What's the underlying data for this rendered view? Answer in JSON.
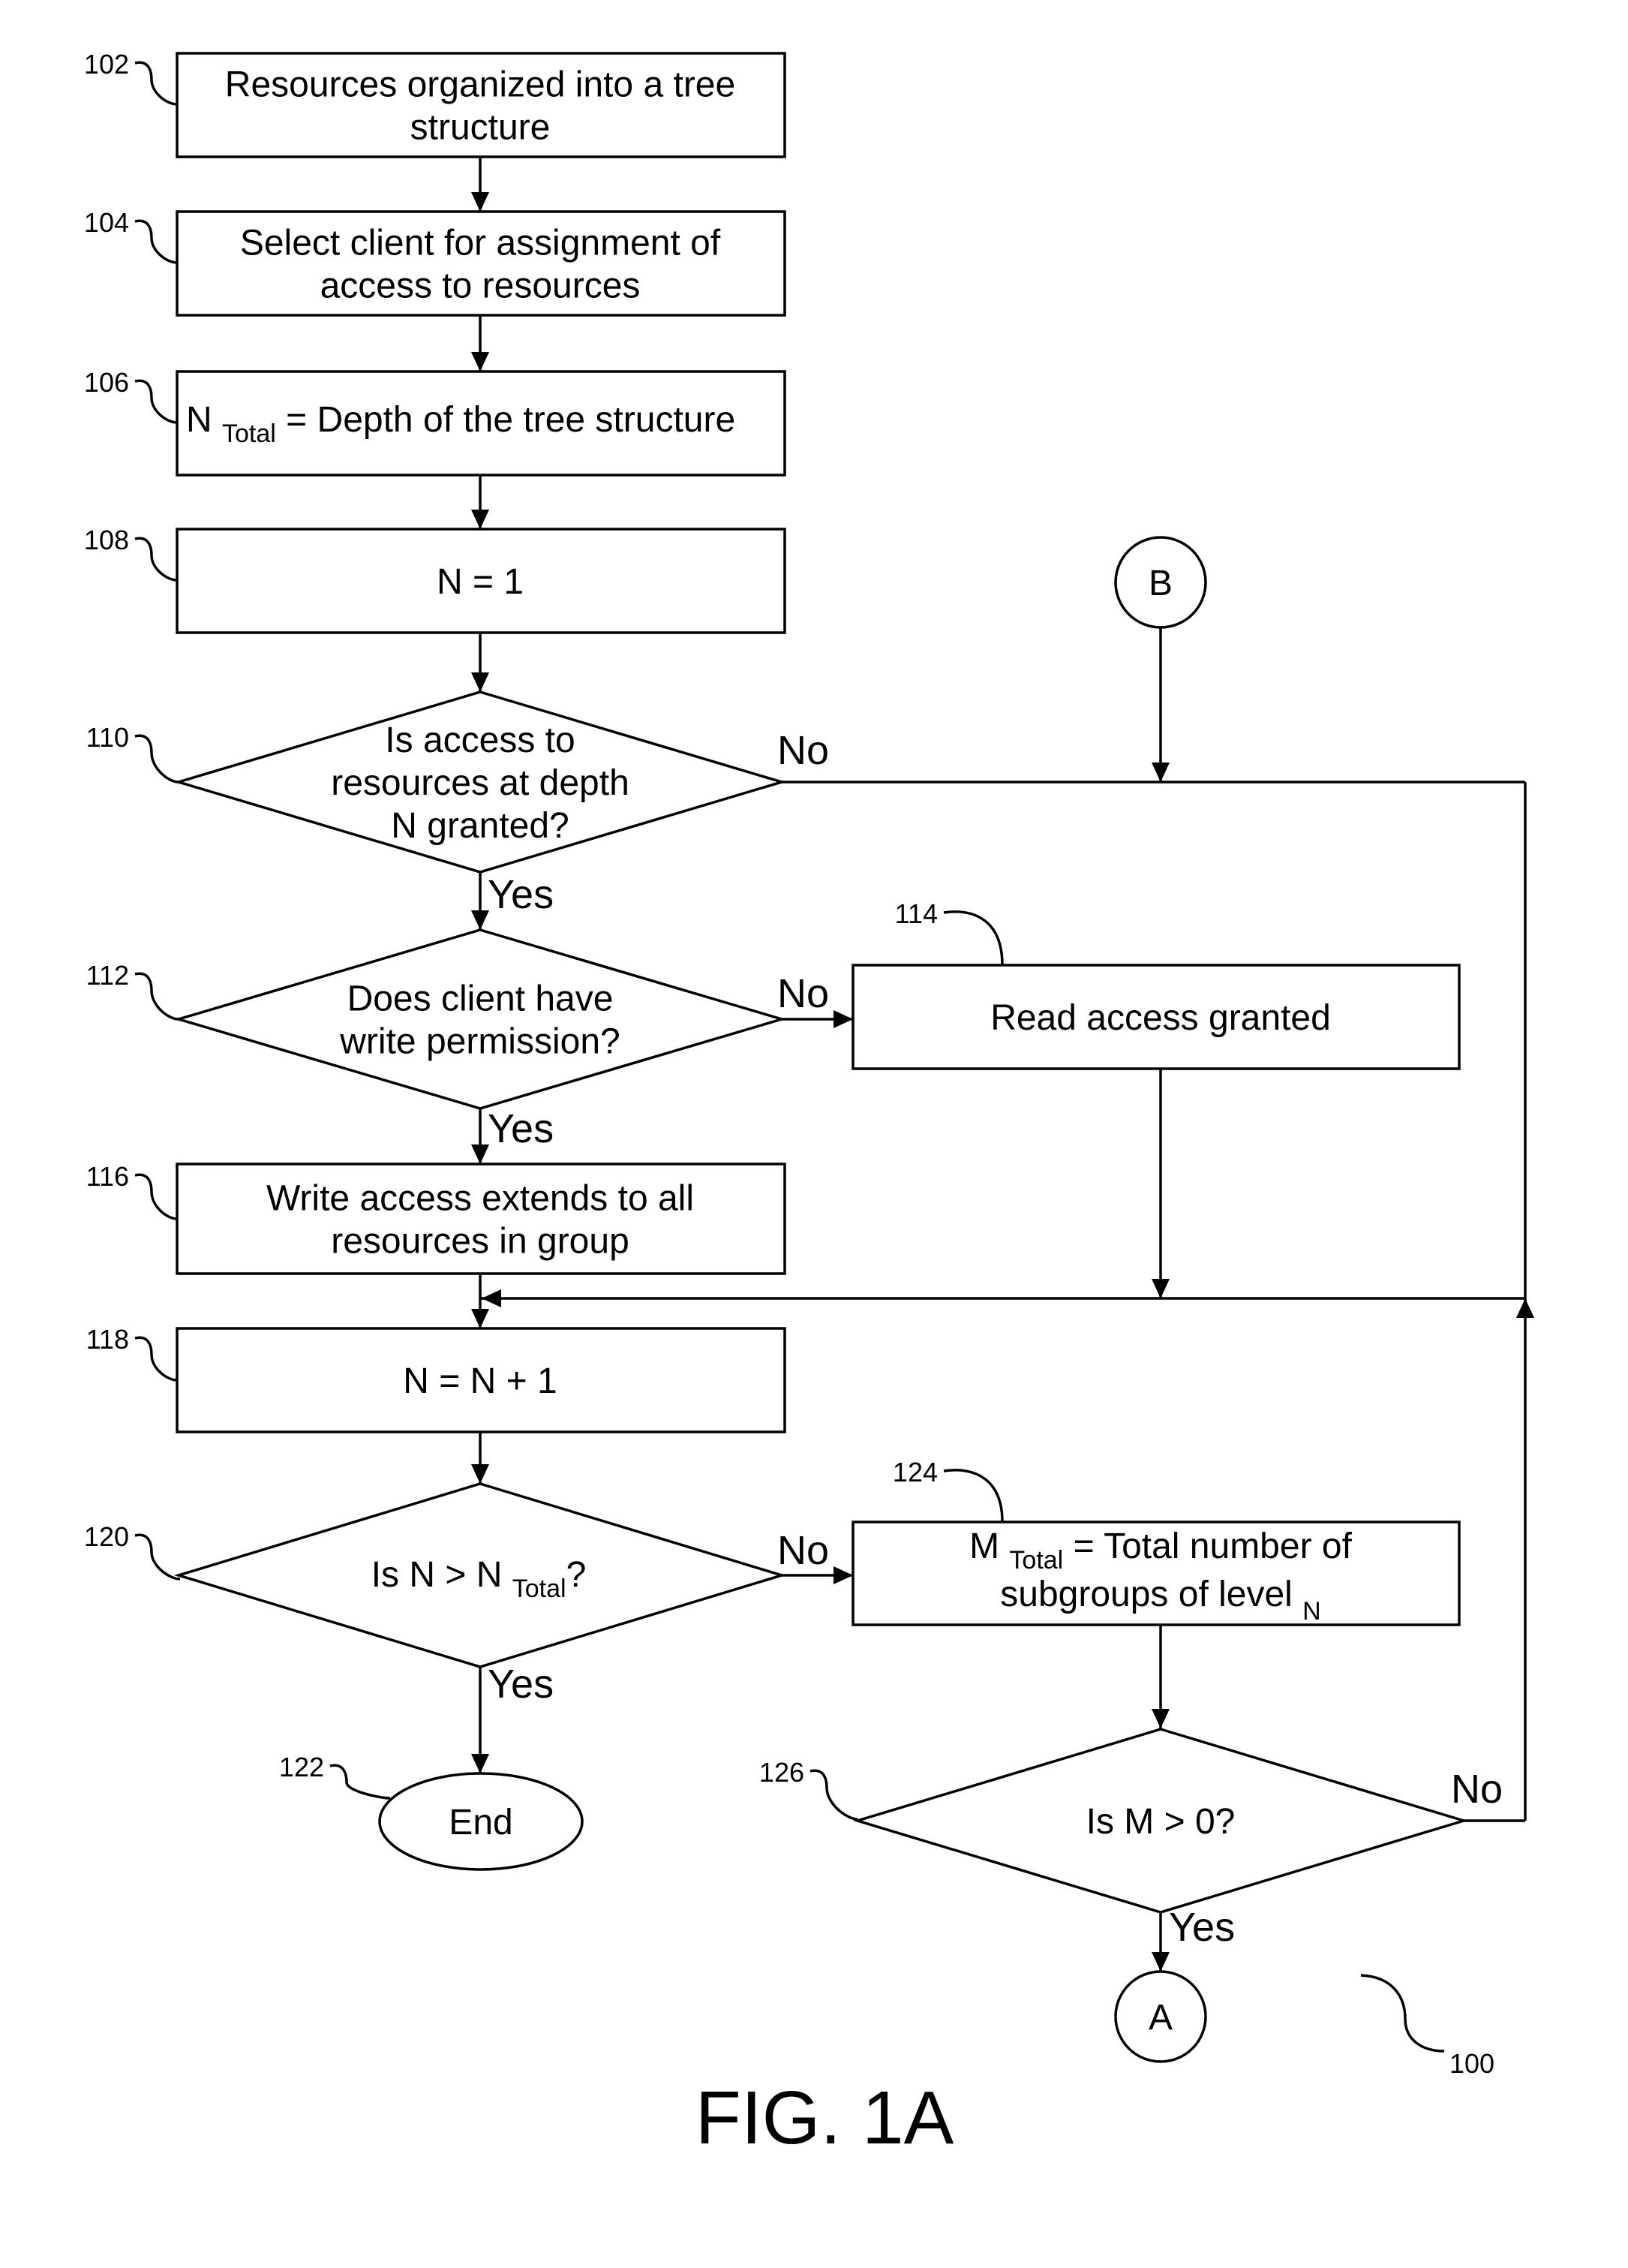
{
  "figure": {
    "title": "FIG. 1A",
    "reference": "100"
  },
  "nodes": {
    "n102": {
      "ref": "102",
      "type": "process",
      "lines": [
        "Resources organized into a tree",
        "structure"
      ]
    },
    "n104": {
      "ref": "104",
      "type": "process",
      "lines": [
        "Select client for assignment of",
        "access to resources"
      ]
    },
    "n106": {
      "ref": "106",
      "type": "process",
      "main": "N",
      "subscript": "Total",
      "rest": "= Depth of the tree structure"
    },
    "n108": {
      "ref": "108",
      "type": "process",
      "lines": [
        "N = 1"
      ]
    },
    "n110": {
      "ref": "110",
      "type": "decision",
      "lines": [
        "Is access to",
        "resources at depth",
        "N granted?"
      ]
    },
    "n112": {
      "ref": "112",
      "type": "decision",
      "lines": [
        "Does client have",
        "write permission?"
      ]
    },
    "n114": {
      "ref": "114",
      "type": "process",
      "lines": [
        "Read access granted"
      ]
    },
    "n116": {
      "ref": "116",
      "type": "process",
      "lines": [
        "Write access extends to all",
        "resources in group"
      ]
    },
    "n118": {
      "ref": "118",
      "type": "process",
      "lines": [
        "N = N + 1"
      ]
    },
    "n120": {
      "ref": "120",
      "type": "decision",
      "pre": "Is N > N",
      "subscript": "Total",
      "post": "?"
    },
    "n122": {
      "ref": "122",
      "type": "terminator",
      "lines": [
        "End"
      ]
    },
    "n124": {
      "ref": "124",
      "type": "process",
      "line1_main": "M",
      "line1_sub": "Total",
      "line1_rest": "= Total number of",
      "line2_main": "subgroups of level",
      "line2_sub": "N"
    },
    "n126": {
      "ref": "126",
      "type": "decision",
      "lines": [
        "Is M > 0?"
      ]
    },
    "connB": {
      "type": "connector",
      "label": "B"
    },
    "connA": {
      "type": "connector",
      "label": "A"
    }
  },
  "edge_labels": {
    "n110_no": "No",
    "n110_yes": "Yes",
    "n112_no": "No",
    "n112_yes": "Yes",
    "n120_no": "No",
    "n120_yes": "Yes",
    "n126_no": "No",
    "n126_yes": "Yes"
  },
  "edges": [
    {
      "from": "n102",
      "to": "n104"
    },
    {
      "from": "n104",
      "to": "n106"
    },
    {
      "from": "n106",
      "to": "n108"
    },
    {
      "from": "n108",
      "to": "n110"
    },
    {
      "from": "n110",
      "to": "n112",
      "label": "Yes"
    },
    {
      "from": "n110",
      "to": "merge",
      "label": "No"
    },
    {
      "from": "connB",
      "to": "merge"
    },
    {
      "from": "n112",
      "to": "n114",
      "label": "No"
    },
    {
      "from": "n112",
      "to": "n116",
      "label": "Yes"
    },
    {
      "from": "n114",
      "to": "merge"
    },
    {
      "from": "n116",
      "to": "n118"
    },
    {
      "from": "merge",
      "to": "n118"
    },
    {
      "from": "n118",
      "to": "n120"
    },
    {
      "from": "n120",
      "to": "n122",
      "label": "Yes"
    },
    {
      "from": "n120",
      "to": "n124",
      "label": "No"
    },
    {
      "from": "n124",
      "to": "n126"
    },
    {
      "from": "n126",
      "to": "connA",
      "label": "Yes"
    },
    {
      "from": "n126",
      "to": "merge",
      "label": "No"
    }
  ]
}
